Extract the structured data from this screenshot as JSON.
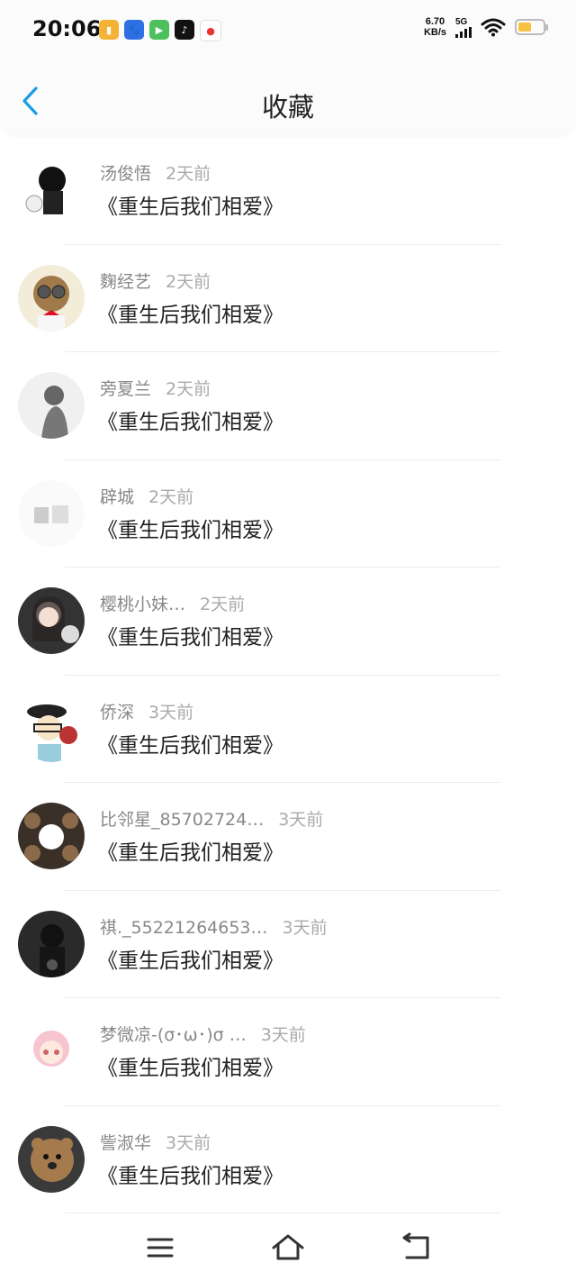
{
  "status_bar": {
    "time": "20:06",
    "net_speed_value": "6.70",
    "net_speed_unit": "KB/s",
    "network_type": "5G",
    "battery_level": 0.55
  },
  "header": {
    "title": "收藏"
  },
  "favorites": [
    {
      "user": "汤俊悟",
      "time": "2天前",
      "book": "《重生后我们相爱》"
    },
    {
      "user": "麴经艺",
      "time": "2天前",
      "book": "《重生后我们相爱》"
    },
    {
      "user": "旁夏兰",
      "time": "2天前",
      "book": "《重生后我们相爱》"
    },
    {
      "user": "辟城",
      "time": "2天前",
      "book": "《重生后我们相爱》"
    },
    {
      "user": "樱桃小妹…",
      "time": "2天前",
      "book": "《重生后我们相爱》"
    },
    {
      "user": "侨深",
      "time": "3天前",
      "book": "《重生后我们相爱》"
    },
    {
      "user": "比邻星_85702724…",
      "time": "3天前",
      "book": "《重生后我们相爱》"
    },
    {
      "user": "祺._55221264653…",
      "time": "3天前",
      "book": "《重生后我们相爱》"
    },
    {
      "user": "梦微凉-(σ･ω･)σ …",
      "time": "3天前",
      "book": "《重生后我们相爱》"
    },
    {
      "user": "訾淑华",
      "time": "3天前",
      "book": "《重生后我们相爱》"
    }
  ],
  "colors": {
    "accent": "#1a9be6",
    "battery": "#f5c242"
  }
}
